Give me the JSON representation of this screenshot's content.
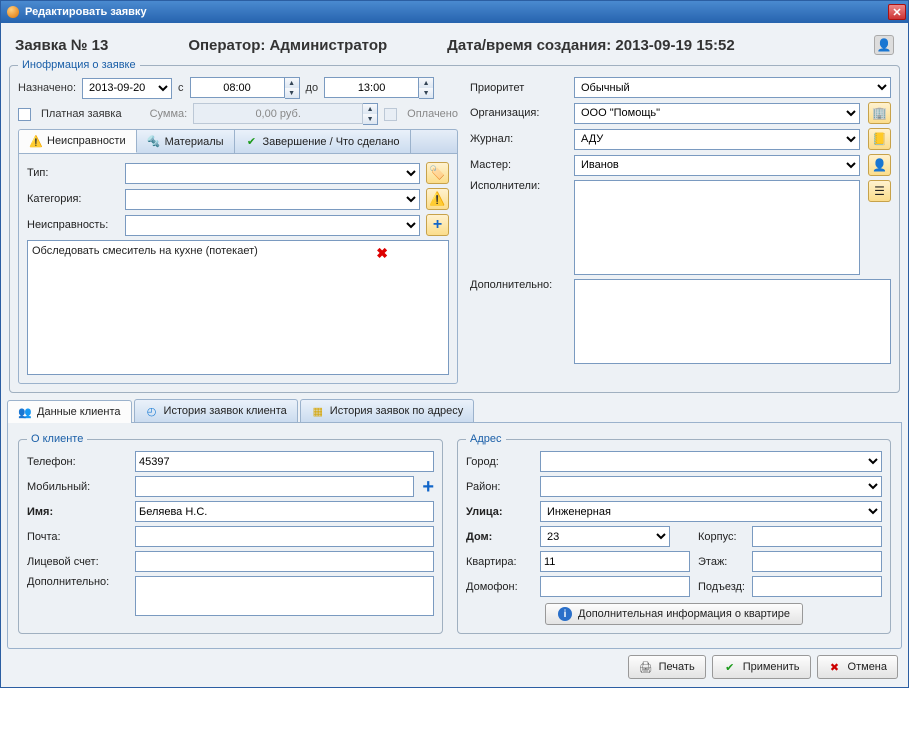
{
  "title": "Редактировать заявку",
  "header": {
    "request_no_label": "Заявка №",
    "request_no": "13",
    "operator_label": "Оператор:",
    "operator": "Администратор",
    "created_label": "Дата/время создания:",
    "created": "2013-09-19 15:52"
  },
  "info_legend": "Инофрмация о заявке",
  "assign": {
    "label": "Назначено:",
    "date": "2013-09-20",
    "from_lbl": "с",
    "from": "08:00",
    "to_lbl": "до",
    "to": "13:00"
  },
  "paid": {
    "label": "Платная заявка",
    "sum_label": "Сумма:",
    "sum": "0,00 руб.",
    "paid_label": "Оплачено"
  },
  "tabs_info": {
    "defects": "Неисправности",
    "materials": "Материалы",
    "done": "Завершение / Что сделано"
  },
  "defects": {
    "type_lbl": "Тип:",
    "category_lbl": "Категория:",
    "defect_lbl": "Неисправность:",
    "item1": "Обследовать смеситель на кухне (потекает)"
  },
  "right": {
    "priority_lbl": "Приоритет",
    "priority": "Обычный",
    "org_lbl": "Организация:",
    "org": "ООО \"Помощь\"",
    "journal_lbl": "Журнал:",
    "journal": "АДУ",
    "master_lbl": "Мастер:",
    "master": "Иванов",
    "executors_lbl": "Исполнители:",
    "additional_lbl": "Дополнительно:"
  },
  "tabs_client": {
    "client": "Данные клиента",
    "history_client": "История заявок клиента",
    "history_addr": "История заявок по адресу"
  },
  "client_box_legend": "О клиенте",
  "client": {
    "phone_lbl": "Телефон:",
    "phone": "45397",
    "mobile_lbl": "Мобильный:",
    "mobile": "",
    "name_lbl": "Имя:",
    "name": "Беляева Н.С.",
    "email_lbl": "Почта:",
    "email": "",
    "account_lbl": "Лицевой счет:",
    "account": "",
    "extra_lbl": "Дополнительно:",
    "extra": ""
  },
  "addr_legend": "Адрес",
  "addr": {
    "city_lbl": "Город:",
    "district_lbl": "Район:",
    "street_lbl": "Улица:",
    "street": "Инженерная",
    "house_lbl": "Дом:",
    "house": "23",
    "korpus_lbl": "Корпус:",
    "flat_lbl": "Квартира:",
    "flat": "11",
    "floor_lbl": "Этаж:",
    "intercom_lbl": "Домофон:",
    "entrance_lbl": "Подъезд:",
    "more_btn": "Дополнительная информация о квартире"
  },
  "buttons": {
    "print": "Печать",
    "apply": "Применить",
    "cancel": "Отмена"
  }
}
